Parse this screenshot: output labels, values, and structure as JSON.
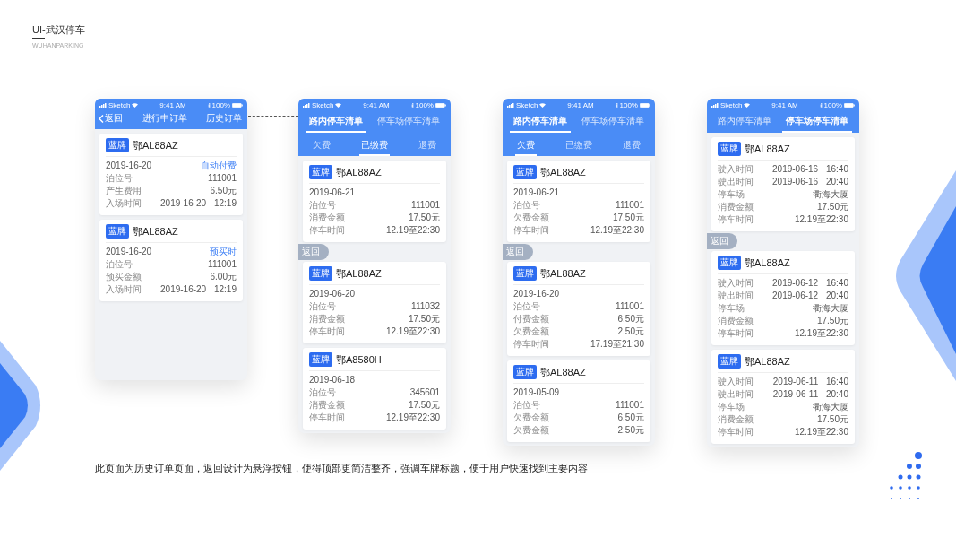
{
  "title": "UI-武汉停车",
  "subtitle": "WUHANPARKING",
  "phones": [
    {
      "kind": "orders",
      "status": {
        "carrier": "Sketch",
        "time": "9:41 AM",
        "battery": "100%"
      },
      "nav": {
        "back": "返回",
        "title": "进行中订单",
        "action": "历史订单"
      },
      "cards": [
        {
          "badge": "蓝牌",
          "plate": "鄂AL88AZ",
          "date": "2019-16-20",
          "state": "自动付费",
          "rows": [
            {
              "label": "泊位号",
              "value": "111001"
            },
            {
              "label": "产生费用",
              "value": "6.50元"
            },
            {
              "label": "入场时间",
              "value": "2019-16-20 12:19"
            }
          ]
        },
        {
          "badge": "蓝牌",
          "plate": "鄂AL88AZ",
          "date": "2019-16-20",
          "state": "预买时",
          "rows": [
            {
              "label": "泊位号",
              "value": "111001"
            },
            {
              "label": "预买金额",
              "value": "6.00元"
            },
            {
              "label": "入场时间",
              "value": "2019-16-20 12:19"
            }
          ]
        }
      ]
    },
    {
      "kind": "list",
      "status": {
        "carrier": "Sketch",
        "time": "9:41 AM",
        "battery": "100%"
      },
      "tabs": [
        {
          "label": "路内停车清单",
          "selected": true
        },
        {
          "label": "停车场停车清单",
          "selected": false
        }
      ],
      "subtabs": [
        {
          "label": "欠费",
          "selected": false
        },
        {
          "label": "已缴费",
          "selected": true
        },
        {
          "label": "退费",
          "selected": false
        }
      ],
      "float_button": "返回",
      "cards": [
        {
          "badge": "蓝牌",
          "plate": "鄂AL88AZ",
          "date": "2019-06-21",
          "rows": [
            {
              "label": "泊位号",
              "value": "111001"
            },
            {
              "label": "消费金额",
              "value": "17.50元"
            },
            {
              "label": "停车时间",
              "value": "12.19至22:30"
            }
          ]
        },
        {
          "badge": "蓝牌",
          "plate": "鄂AL88AZ",
          "date": "2019-06-20",
          "rows": [
            {
              "label": "泊位号",
              "value": "111032"
            },
            {
              "label": "消费金额",
              "value": "17.50元"
            },
            {
              "label": "停车时间",
              "value": "12.19至22:30"
            }
          ]
        },
        {
          "badge": "蓝牌",
          "plate": "鄂A8580H",
          "date": "2019-06-18",
          "rows": [
            {
              "label": "泊位号",
              "value": "345601"
            },
            {
              "label": "消费金额",
              "value": "17.50元"
            },
            {
              "label": "停车时间",
              "value": "12.19至22:30"
            }
          ]
        }
      ]
    },
    {
      "kind": "list",
      "status": {
        "carrier": "Sketch",
        "time": "9:41 AM",
        "battery": "100%"
      },
      "tabs": [
        {
          "label": "路内停车清单",
          "selected": true
        },
        {
          "label": "停车场停车清单",
          "selected": false
        }
      ],
      "subtabs": [
        {
          "label": "欠费",
          "selected": true
        },
        {
          "label": "已缴费",
          "selected": false
        },
        {
          "label": "退费",
          "selected": false
        }
      ],
      "float_button": "返回",
      "cards": [
        {
          "badge": "蓝牌",
          "plate": "鄂AL88AZ",
          "date": "2019-06-21",
          "rows": [
            {
              "label": "泊位号",
              "value": "111001"
            },
            {
              "label": "欠费金额",
              "value": "17.50元"
            },
            {
              "label": "停车时间",
              "value": "12.19至22:30"
            }
          ]
        },
        {
          "badge": "蓝牌",
          "plate": "鄂AL88AZ",
          "date": "2019-16-20",
          "rows": [
            {
              "label": "泊位号",
              "value": "111001"
            },
            {
              "label": "付费金额",
              "value": "6.50元"
            },
            {
              "label": "欠费金额",
              "value": "2.50元"
            },
            {
              "label": "停车时间",
              "value": "17.19至21:30"
            }
          ]
        },
        {
          "badge": "蓝牌",
          "plate": "鄂AL88AZ",
          "date": "2019-05-09",
          "rows": [
            {
              "label": "泊位号",
              "value": "111001"
            },
            {
              "label": "欠费金额",
              "value": "6.50元"
            },
            {
              "label": "欠费金额",
              "value": "2.50元"
            }
          ]
        }
      ]
    },
    {
      "kind": "list",
      "status": {
        "carrier": "Sketch",
        "time": "9:41 AM",
        "battery": "100%"
      },
      "tabs": [
        {
          "label": "路内停车清单",
          "selected": false
        },
        {
          "label": "停车场停车清单",
          "selected": true
        }
      ],
      "float_button": "返回",
      "cards": [
        {
          "badge": "蓝牌",
          "plate": "鄂AL88AZ",
          "rows": [
            {
              "label": "驶入时间",
              "value": "2019-06-16 16:40"
            },
            {
              "label": "驶出时间",
              "value": "2019-06-16 20:40"
            },
            {
              "label": "停车场",
              "value": "衢海大厦"
            },
            {
              "label": "消费金额",
              "value": "17.50元"
            },
            {
              "label": "停车时间",
              "value": "12.19至22:30"
            }
          ]
        },
        {
          "badge": "蓝牌",
          "plate": "鄂AL88AZ",
          "rows": [
            {
              "label": "驶入时间",
              "value": "2019-06-12 16:40"
            },
            {
              "label": "驶出时间",
              "value": "2019-06-12 20:40"
            },
            {
              "label": "停车场",
              "value": "衢海大厦"
            },
            {
              "label": "消费金额",
              "value": "17.50元"
            },
            {
              "label": "停车时间",
              "value": "12.19至22:30"
            }
          ]
        },
        {
          "badge": "蓝牌",
          "plate": "鄂AL88AZ",
          "rows": [
            {
              "label": "驶入时间",
              "value": "2019-06-11 16:40"
            },
            {
              "label": "驶出时间",
              "value": "2019-06-11 20:40"
            },
            {
              "label": "停车场",
              "value": "衢海大厦"
            },
            {
              "label": "消费金额",
              "value": "17.50元"
            },
            {
              "label": "停车时间",
              "value": "12.19至22:30"
            }
          ]
        }
      ]
    }
  ],
  "caption": "此页面为历史订单页面，返回设计为悬浮按钮，使得顶部更简洁整齐，强调车牌标题，便于用户快速找到主要内容"
}
